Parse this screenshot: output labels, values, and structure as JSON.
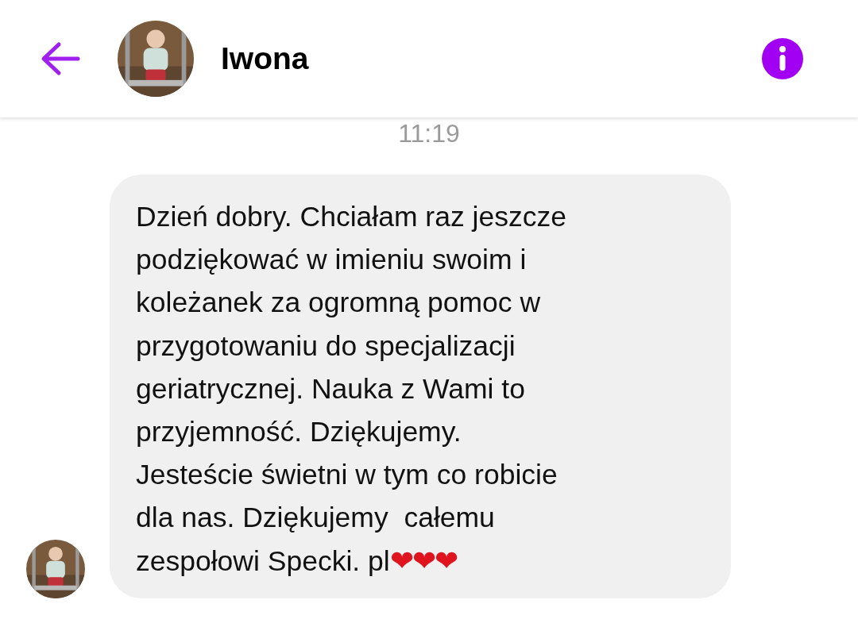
{
  "header": {
    "contact_name": "Iwona"
  },
  "timestamp": "11:19",
  "messages": [
    {
      "text": "Dzień dobry. Chciałam raz jeszcze\npodziękować w imieniu swoim i\nkoleżanek za ogromną pomoc w\nprzygotowaniu do specjalizacji\ngeriatrycznej. Nauka z Wami to\nprzyjemność. Dziękujemy.\nJesteście świetni w tym co robicie\ndla nas. Dziękujemy  całemu\nzespołowi Specki. pl",
      "emoji": "❤❤❤"
    }
  ]
}
